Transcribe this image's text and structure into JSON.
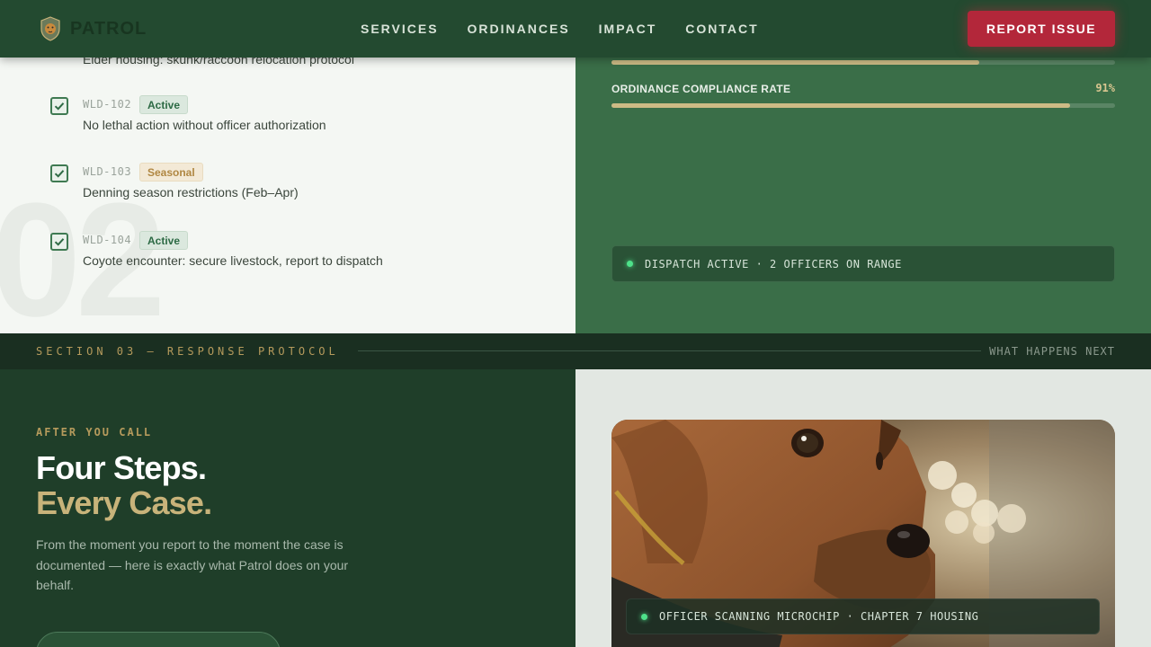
{
  "nav": {
    "brand": "PATROL",
    "links": [
      "SERVICES",
      "ORDINANCES",
      "IMPACT",
      "CONTACT"
    ],
    "report_label": "REPORT ISSUE"
  },
  "protocol": {
    "section_number": "02",
    "previous_item_text": "Elder housing: skunk/raccoon relocation protocol",
    "items": [
      {
        "code": "WLD-102",
        "status": "Active",
        "text": "No lethal action without officer authorization"
      },
      {
        "code": "WLD-103",
        "status": "Seasonal",
        "text": "Denning season restrictions (Feb–Apr)"
      },
      {
        "code": "WLD-104",
        "status": "Active",
        "text": "Coyote encounter: secure livestock, report to dispatch"
      }
    ]
  },
  "stats": {
    "previous_bar_fill": 0.73,
    "compliance_label": "ORDINANCE COMPLIANCE RATE",
    "compliance_value": "91%",
    "compliance_fill": 0.91,
    "dispatch_text": "DISPATCH ACTIVE · 2 OFFICERS ON RANGE"
  },
  "section": {
    "label": "SECTION 03 — RESPONSE PROTOCOL",
    "right_label": "WHAT HAPPENS NEXT"
  },
  "after": {
    "eyebrow": "AFTER YOU CALL",
    "headline_1": "Four Steps.",
    "headline_2": "Every Case.",
    "lede": "From the moment you report to the moment the case is documented — here is exactly what Patrol does on your behalf."
  },
  "photo": {
    "caption": "OFFICER SCANNING MICROCHIP · CHAPTER 7 HOUSING"
  },
  "colors": {
    "accent_red": "#b3273a",
    "forest": "#234a30",
    "gold": "#c8b37a",
    "status_green": "#4ee28a"
  }
}
